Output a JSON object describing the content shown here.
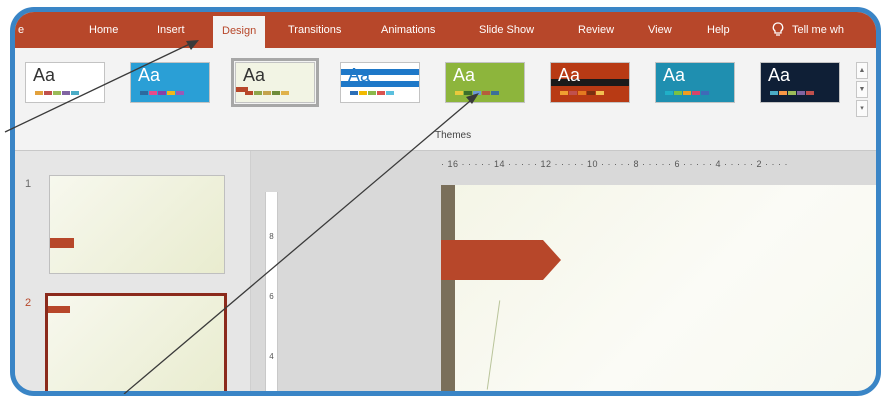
{
  "tabs": {
    "file_partial": "e",
    "home": "Home",
    "insert": "Insert",
    "design": "Design",
    "transitions": "Transitions",
    "animations": "Animations",
    "slideshow": "Slide Show",
    "review": "Review",
    "view": "View",
    "help": "Help",
    "tellme": "Tell me wh"
  },
  "themes": [
    {
      "label": "Aa",
      "bg": "#ffffff",
      "fg": "#333333",
      "swatches": [
        "#e2a13c",
        "#c0504d",
        "#9bbb59",
        "#8064a2",
        "#4bacc6"
      ]
    },
    {
      "label": "Aa",
      "bg": "#2a9fd6",
      "fg": "#ffffff",
      "swatches": [
        "#2c6aa0",
        "#e64b8a",
        "#8a3fa8",
        "#f0b81a",
        "#9b59b6"
      ]
    },
    {
      "label": "Aa",
      "bg": "#f2f4e4",
      "fg": "#333333",
      "swatches": [
        "#b7472a",
        "#8ea64a",
        "#c4a34c",
        "#6e8c3a",
        "#e0b24a"
      ]
    },
    {
      "label": "Aa",
      "bg": "#ffffff",
      "fg": "#1e78c8",
      "swatches": [
        "#2d6fb7",
        "#f2b900",
        "#8bb84a",
        "#d9534f",
        "#5bc0de"
      ]
    },
    {
      "label": "Aa",
      "bg": "#8db53c",
      "fg": "#ffffff",
      "swatches": [
        "#e9c93c",
        "#3c6f2a",
        "#6d9ad3",
        "#b55e3c",
        "#3c6f9a"
      ]
    },
    {
      "label": "Aa",
      "bg": "#b83a14",
      "fg": "#ffffff",
      "swatches": [
        "#f0a030",
        "#c0504d",
        "#e47a20",
        "#7a3010",
        "#f2c050"
      ]
    },
    {
      "label": "Aa",
      "bg": "#1f8fb0",
      "fg": "#ffffff",
      "swatches": [
        "#1fb0c8",
        "#7ac143",
        "#f29c1f",
        "#d6466a",
        "#3f6ab8"
      ]
    },
    {
      "label": "Aa",
      "bg": "#0f1f36",
      "fg": "#ffffff",
      "swatches": [
        "#4bacc6",
        "#f79646",
        "#9bbb59",
        "#8064a2",
        "#c0504d"
      ]
    }
  ],
  "ribbon": {
    "group_label": "Themes",
    "scroll_up": "▲",
    "scroll_down": "▼",
    "more": "▾"
  },
  "slides": [
    {
      "number": "1"
    },
    {
      "number": "2"
    }
  ],
  "ruler": {
    "horizontal": "· 16 · · · · · 14 · · · · · 12 · · · · · 10 · · · · · 8 · · · · · 6 · · · · · 4 · · · · · 2 · · · ·",
    "vertical": [
      "8",
      "6",
      "4"
    ]
  },
  "colors": {
    "accent": "#b7472a",
    "frame": "#3a85c6"
  }
}
